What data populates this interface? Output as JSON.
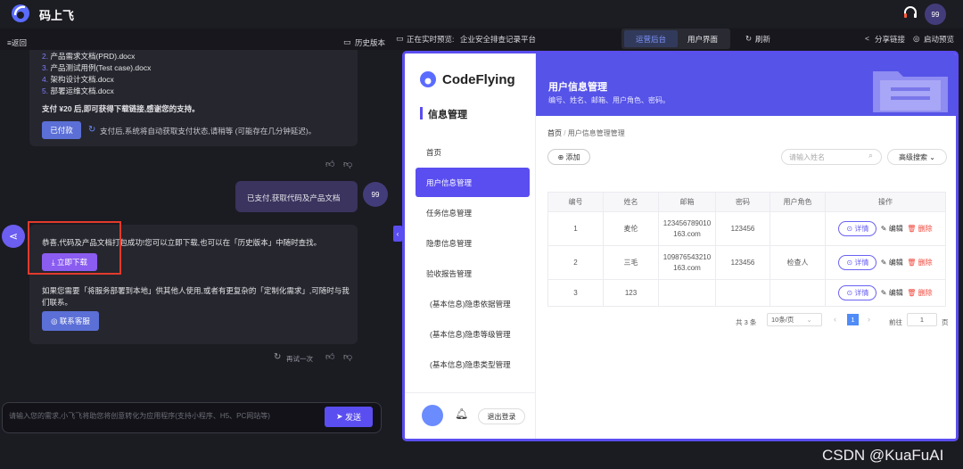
{
  "app": {
    "brand": "码上飞",
    "avatar": "99"
  },
  "subbar": {
    "back": "≡返回",
    "history": "历史版本",
    "preview_label": "正在实时预览:",
    "preview_name": "企业安全排查记录平台",
    "tab_admin": "运营后台",
    "tab_user": "用户界面",
    "refresh": "刷新",
    "share": "分享链接",
    "launch": "启动预览"
  },
  "chat": {
    "docs": [
      {
        "n": "2.",
        "t": "产品需求文档(PRD).docx"
      },
      {
        "n": "3.",
        "t": "产品测试用例(Test case).docx"
      },
      {
        "n": "4.",
        "t": "架构设计文档.docx"
      },
      {
        "n": "5.",
        "t": "部署运维文档.docx"
      }
    ],
    "pay_text": "支付 ¥20 后,即可获得下载链接,感谢您的支持。",
    "paid_btn": "已付款",
    "pay_hint": "支付后,系统将自动获取支付状态,请稍等 (可能存在几分钟延迟)。",
    "user_msg": "已支付,获取代码及产品文档",
    "user_avatar": "99",
    "success": "恭喜,代码及产品文档打包成功!您可以立即下载,也可以在「历史版本」中随时查找。",
    "download_btn": "立即下载",
    "deploy_text": "如果您需要「将服务部署到本地」供其他人使用,或者有更复杂的「定制化需求」,可随时与我们联系。",
    "contact_btn": "联系客服",
    "retry": "再试一次",
    "placeholder": "请输入您的需求,小飞飞将助您将创意转化为应用程序(支持小程序、H5、PC网站等)",
    "send": "发送"
  },
  "preview": {
    "logo": "CodeFlying",
    "section": "信息管理",
    "nav": [
      "首页",
      "用户信息管理",
      "任务信息管理",
      "隐患信息管理",
      "验收报告管理",
      "(基本信息)隐患依据管理",
      "(基本信息)隐患等级管理",
      "(基本信息)隐患类型管理"
    ],
    "logout": "退出登录",
    "title": "用户信息管理",
    "subtitle": "编号、姓名、邮箱、用户角色、密码。",
    "crumb_home": "首页",
    "crumb_sep": "/",
    "crumb_cur": "用户信息管理管理",
    "add": "添加",
    "search_ph": "请输入姓名",
    "adv": "高级搜索",
    "cols": [
      "编号",
      "姓名",
      "邮箱",
      "密码",
      "用户角色",
      "操作"
    ],
    "rows": [
      {
        "id": "1",
        "name": "麦伦",
        "email": "123456789010",
        "email2": "163.com",
        "pwd": "123456",
        "role": ""
      },
      {
        "id": "2",
        "name": "三毛",
        "email": "109876543210",
        "email2": "163.com",
        "pwd": "123456",
        "role": "检查人"
      },
      {
        "id": "3",
        "name": "123",
        "email": "",
        "email2": "",
        "pwd": "",
        "role": ""
      }
    ],
    "act_detail": "详情",
    "act_edit": "编辑",
    "act_del": "删除",
    "total": "共 3 条",
    "per_page": "10条/页",
    "page": "1",
    "goto": "前往",
    "goto_val": "1",
    "page_unit": "页"
  },
  "watermark": "CSDN @KuaFuAI",
  "colors": {
    "accent": "#5a4ef0",
    "danger": "#f0453a"
  }
}
